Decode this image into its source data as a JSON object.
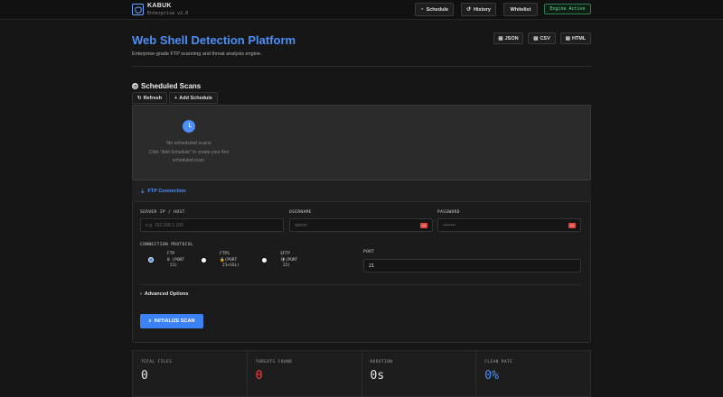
{
  "app": {
    "name": "KABUK",
    "version": "Enterprise v2.0"
  },
  "nav": {
    "schedule": "Schedule",
    "history": "History",
    "whitelist": "Whitelist",
    "engine_status": "Engine Active"
  },
  "header": {
    "title": "Web Shell Detection Platform",
    "subtitle": "Enterprise-grade FTP scanning and threat analysis engine.",
    "export": {
      "json": "JSON",
      "csv": "CSV",
      "html": "HTML"
    }
  },
  "scheduled": {
    "title": "Scheduled Scans",
    "refresh": "Refresh",
    "add": "Add Schedule",
    "empty_title": "No scheduled scans",
    "empty_desc": "Click \"Add Schedule\" to create your first scheduled scan."
  },
  "ftp": {
    "title": "FTP Connection",
    "server_label": "SERVER IP / HOST",
    "server_placeholder": "e.g. 192.168.1.100",
    "username_label": "USERNAME",
    "username_placeholder": "admin",
    "password_label": "PASSWORD",
    "password_placeholder": "••••••••",
    "protocol_label": "CONNECTION PROTOCOL",
    "protocols": [
      {
        "name": "FTP",
        "detail": "0 (PORT",
        "detail2": "21)",
        "selected": true
      },
      {
        "name": "FTPS",
        "detail": "🔒(PORT",
        "detail2": "21+SSL)",
        "selected": false
      },
      {
        "name": "SFTP",
        "detail": "🛡(PORT",
        "detail2": "22)",
        "selected": false
      }
    ],
    "port_label": "PORT",
    "port_value": "21",
    "advanced": "Advanced Options",
    "scan_button": "INITIALIZE SCAN"
  },
  "stats": [
    {
      "label": "TOTAL FILES",
      "value": "0",
      "color": "#e8e8e8"
    },
    {
      "label": "THREATS FOUND",
      "value": "0",
      "color": "#ef4444"
    },
    {
      "label": "DURATION",
      "value": "0s",
      "color": "#e8e8e8"
    },
    {
      "label": "CLEAN RATE",
      "value": "0%",
      "color": "#4d8ff7"
    }
  ],
  "colors": {
    "accent": "#4d8ff7",
    "danger": "#ef4444",
    "success": "#5ee08f"
  }
}
